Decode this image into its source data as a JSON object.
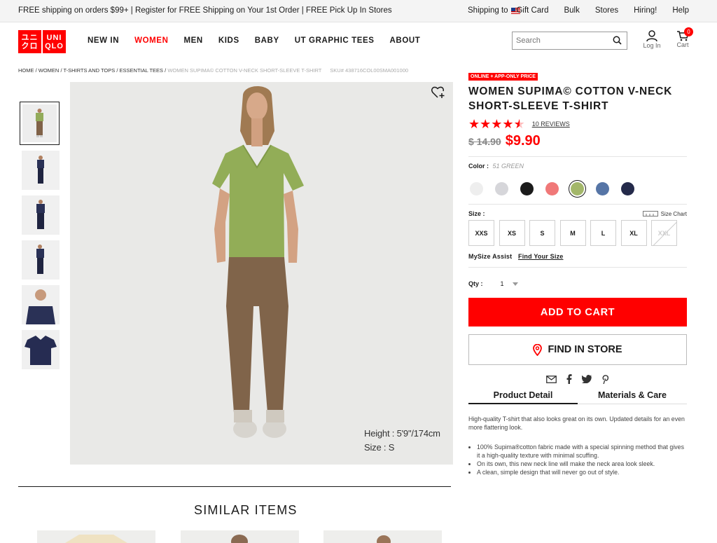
{
  "topbar": {
    "promo": "FREE shipping on orders $99+ | Register for FREE Shipping on Your 1st Order | FREE Pick Up In Stores",
    "shipping_to": "Shipping to",
    "links": [
      "Gift Card",
      "Bulk",
      "Stores",
      "Hiring!",
      "Help"
    ]
  },
  "header": {
    "logo_left": [
      "ユニ",
      "クロ"
    ],
    "logo_right": [
      "UNI",
      "QLO"
    ],
    "nav": [
      "NEW IN",
      "WOMEN",
      "MEN",
      "KIDS",
      "BABY",
      "UT GRAPHIC TEES",
      "ABOUT"
    ],
    "active_nav": "WOMEN",
    "search_placeholder": "Search",
    "login_label": "Log In",
    "cart_label": "Cart",
    "cart_count": "0"
  },
  "breadcrumb": {
    "items": [
      "HOME",
      "WOMEN",
      "T-SHIRTS AND TOPS",
      "ESSENTIAL TEES"
    ],
    "current": "WOMEN SUPIMA© COTTON V-NECK SHORT-SLEEVE T-SHIRT",
    "sku": "SKU# 438716COL00SMA001000"
  },
  "gallery": {
    "model_height": "Height : 5'9\"/174cm",
    "model_size": "Size : S",
    "thumbnails": [
      "green-front",
      "navy-full-1",
      "navy-full-2",
      "navy-full-3",
      "navy-half",
      "navy-flat"
    ]
  },
  "product": {
    "badge": "ONLINE + APP-ONLY PRICE",
    "title": "WOMEN SUPIMA© COTTON V-NECK SHORT-SLEEVE T-SHIRT",
    "rating": 4.5,
    "reviews": "10 REVIEWS",
    "old_price": "$ 14.90",
    "new_price": "$9.90",
    "color_label": "Color :",
    "color_value": "51 GREEN",
    "colors": [
      "#eeeeee",
      "#d6d6da",
      "#1b1b1b",
      "#f07878",
      "#a3b76a",
      "#5675a6",
      "#242a4a"
    ],
    "selected_color_index": 4,
    "size_label": "Size :",
    "size_chart": "Size Chart",
    "sizes": [
      "XXS",
      "XS",
      "S",
      "M",
      "L",
      "XL",
      "XXL"
    ],
    "disabled_sizes": [
      "XXL"
    ],
    "mysize_label": "MySize Assist",
    "mysize_link": "Find Your Size",
    "qty_label": "Qty :",
    "qty_value": "1",
    "add_to_cart": "ADD TO CART",
    "find_in_store": "FIND IN STORE",
    "tabs": [
      "Product Detail",
      "Materials & Care"
    ],
    "description": "High-quality T-shirt that also looks great on its own. Updated details for an even more flattering look.",
    "bullets": [
      "100% Supima®cotton fabric made with a special spinning method that gives it a high-quality texture with minimal scuffing.",
      "On its own, this new neck line will make the neck area look sleek.",
      "A clean, simple design that will never go out of style."
    ]
  },
  "similar": {
    "title": "SIMILAR ITEMS"
  },
  "colors": {
    "brand_red": "#ff0000",
    "text": "#1b1b1b"
  }
}
